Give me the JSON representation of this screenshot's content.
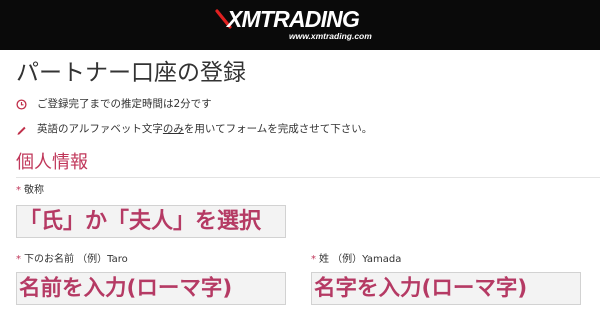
{
  "header": {
    "logo_text": "XMTRADING",
    "logo_url": "www.xmtrading.com"
  },
  "title": "パートナー口座の登録",
  "notices": [
    {
      "icon": "clock-icon",
      "text": "ご登録完了までの推定時間は2分です"
    },
    {
      "icon": "pencil-icon",
      "text_before": "英語のアルファベット文字",
      "text_underline": "のみ",
      "text_after": "を用いてフォームを完成させて下さい。"
    }
  ],
  "section_title": "個人情報",
  "fields": {
    "title_field": {
      "required_mark": "*",
      "label": "敬称",
      "hint": "「氏」か「夫人」を選択"
    },
    "first_name": {
      "required_mark": "*",
      "label": "下のお名前 （例）Taro",
      "hint": "名前を入力(ローマ字)"
    },
    "last_name": {
      "required_mark": "*",
      "label": "姓 （例）Yamada",
      "hint": "名字を入力(ローマ字)"
    }
  },
  "colors": {
    "header_bg": "#0a0a0a",
    "accent": "#c0375a",
    "hint_text": "#b53a64",
    "icon_red": "#c0304a"
  }
}
